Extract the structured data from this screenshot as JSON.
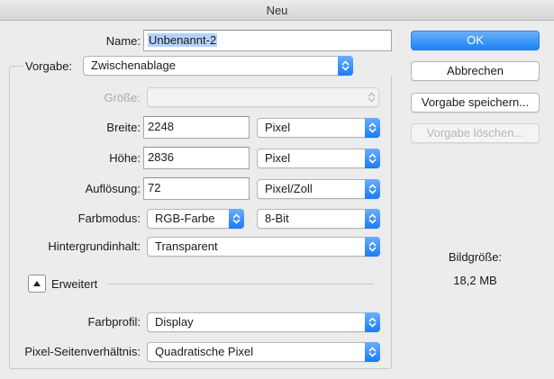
{
  "window": {
    "title": "Neu"
  },
  "form": {
    "name_label": "Name:",
    "name_value": "Unbenannt-2",
    "preset_label": "Vorgabe:",
    "preset_value": "Zwischenablage",
    "size_label": "Größe:",
    "size_value": "",
    "width_label": "Breite:",
    "width_value": "2248",
    "width_unit": "Pixel",
    "height_label": "Höhe:",
    "height_value": "2836",
    "height_unit": "Pixel",
    "resolution_label": "Auflösung:",
    "resolution_value": "72",
    "resolution_unit": "Pixel/Zoll",
    "colormode_label": "Farbmodus:",
    "colormode_value": "RGB-Farbe",
    "bitdepth_value": "8-Bit",
    "background_label": "Hintergrundinhalt:",
    "background_value": "Transparent",
    "advanced_label": "Erweitert",
    "profile_label": "Farbprofil:",
    "profile_value": "Display",
    "aspect_label": "Pixel-Seitenverhältnis:",
    "aspect_value": "Quadratische Pixel"
  },
  "buttons": {
    "ok": "OK",
    "cancel": "Abbrechen",
    "save_preset": "Vorgabe speichern...",
    "delete_preset": "Vorgabe löschen..."
  },
  "info": {
    "image_size_label": "Bildgröße:",
    "image_size_value": "18,2 MB"
  },
  "colors": {
    "accent": "#1c82f5",
    "selection": "#b3d3fd"
  }
}
